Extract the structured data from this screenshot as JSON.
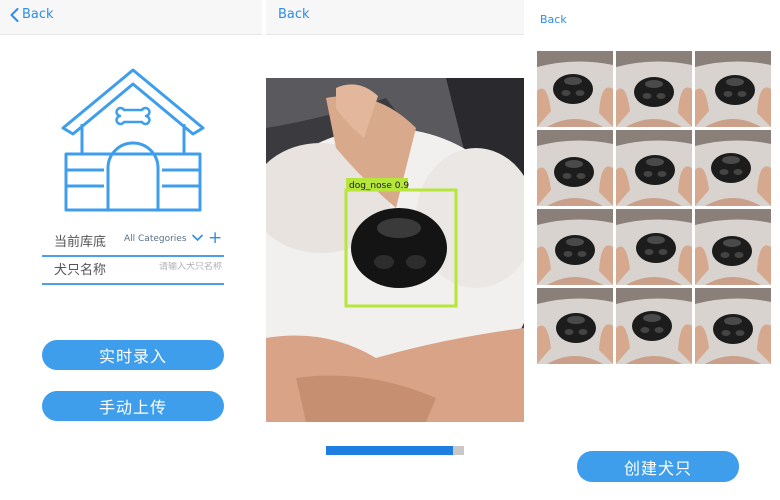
{
  "screen1": {
    "back_label": "Back",
    "current_library_label": "当前库底",
    "category_value": "All Categories",
    "dog_name_label": "犬只名称",
    "dog_name_placeholder": "请输入犬只名称",
    "realtime_entry_button": "实时录入",
    "manual_upload_button": "手动上传"
  },
  "screen2": {
    "back_label": "Back",
    "detection": {
      "label": "dog_nose",
      "confidence": "0.9",
      "box_color": "#b6e63a"
    },
    "progress": {
      "fraction": 0.92
    }
  },
  "screen3": {
    "back_label": "Back",
    "thumbnail_count": 12,
    "create_dog_button": "创建犬只"
  },
  "colors": {
    "accent": "#3f9eec",
    "link": "#2f8de6",
    "progress": "#1f7fe0"
  }
}
